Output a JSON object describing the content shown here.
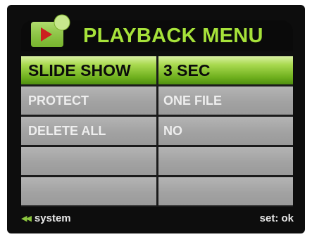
{
  "header": {
    "title": "PLAYBACK MENU",
    "icon": "playback-icon",
    "title_color": "#a6e23a"
  },
  "menu": {
    "rows": [
      {
        "label": "SLIDE SHOW",
        "value": "3 SEC",
        "selected": true
      },
      {
        "label": "PROTECT",
        "value": "ONE FILE",
        "selected": false
      },
      {
        "label": "DELETE ALL",
        "value": "NO",
        "selected": false
      },
      {
        "label": "",
        "value": "",
        "selected": false
      },
      {
        "label": "",
        "value": "",
        "selected": false
      }
    ],
    "selected_color": "#7ab82a",
    "normal_color": "#a6a6a6"
  },
  "footer": {
    "back_icon": "double-left-arrow-icon",
    "back_label": "system",
    "set_label": "set: ok"
  }
}
